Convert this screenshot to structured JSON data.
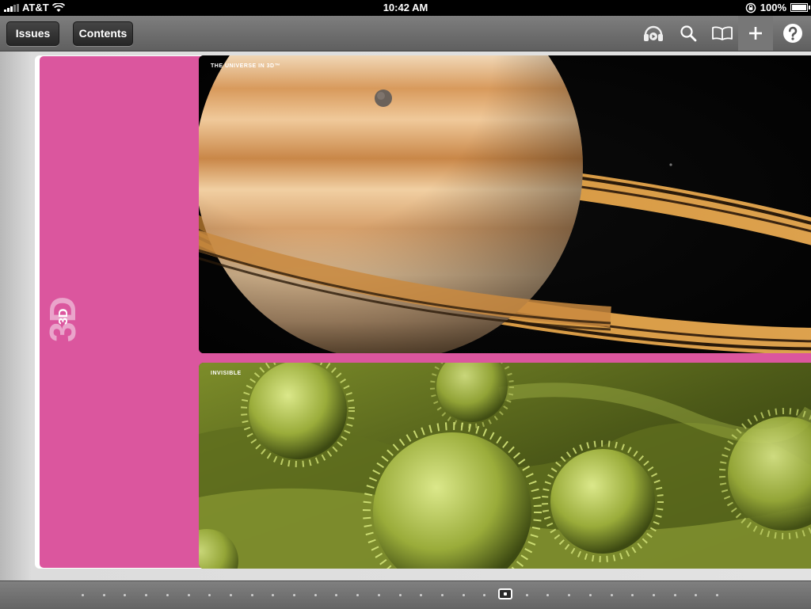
{
  "status_bar": {
    "carrier": "AT&T",
    "time": "10:42 AM",
    "battery": "100%"
  },
  "toolbar": {
    "issues_label": "Issues",
    "contents_label": "Contents",
    "icons": [
      "audio-icon",
      "search-icon",
      "book-icon",
      "plus-icon",
      "help-icon"
    ]
  },
  "page": {
    "section_label_big": "3D",
    "section_label_small": "3D",
    "saturn_title": "THE UNIVERSE IN 3D™",
    "pollen_title": "INVISIBLE",
    "accent_color": "#db569e"
  },
  "navigation": {
    "dot_count": 30,
    "current_dot_index": 20
  }
}
